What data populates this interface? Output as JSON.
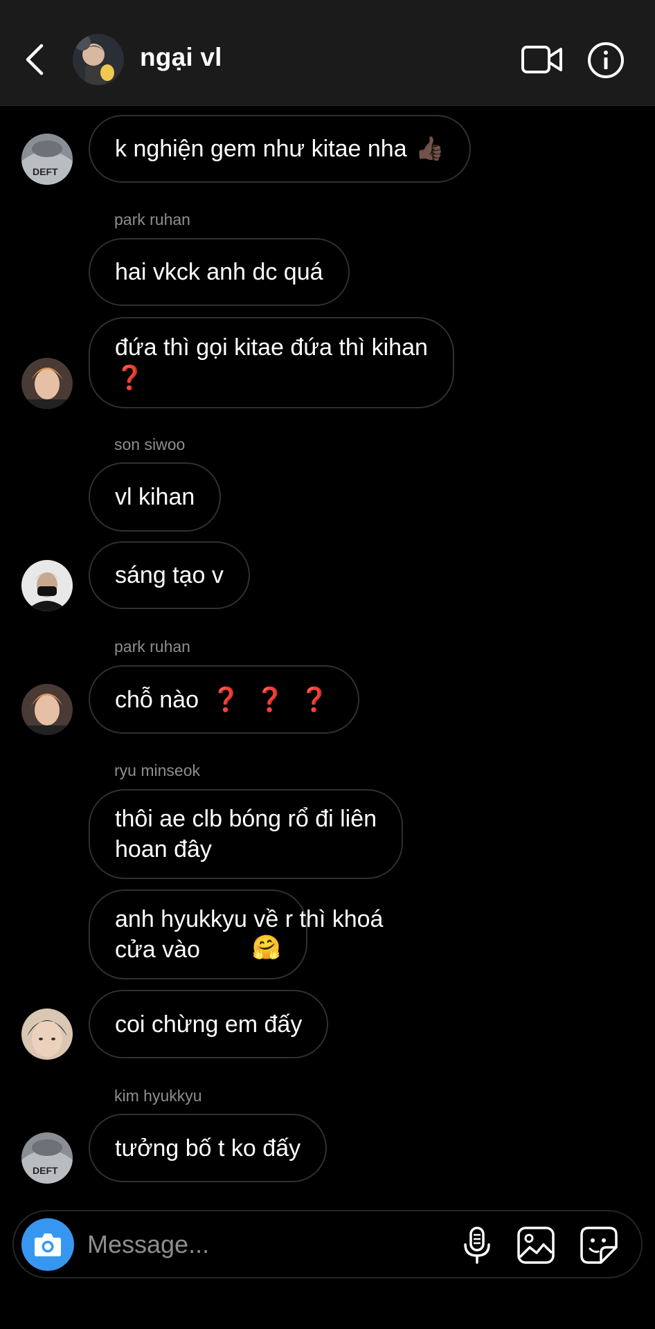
{
  "header": {
    "title": "ngại vl"
  },
  "messages": [
    {
      "sender": "",
      "text": "k nghiện gem như kitae nha",
      "emoji": "👍🏿",
      "avatar": "deft"
    },
    {
      "sender": "park ruhan",
      "text": "hai vkck anh dc quá",
      "avatar": ""
    },
    {
      "sender": "",
      "text": "đứa thì gọi kitae đứa thì kihan",
      "line2": "❓",
      "avatar": "orange"
    },
    {
      "sender": "son siwoo",
      "text": "vl kihan",
      "avatar": ""
    },
    {
      "sender": "",
      "text": "sáng tạo v",
      "avatar": "mask"
    },
    {
      "sender": "park ruhan",
      "text": "chỗ nào",
      "emoji": "❓ ❓ ❓",
      "avatar": "orange"
    },
    {
      "sender": "ryu minseok",
      "text": "thôi ae clb bóng rổ đi liên\nhoan đây",
      "avatar": ""
    },
    {
      "sender": "",
      "text": "anh hyukkyu về r thì khoá\ncửa vào",
      "emoji": "🤗",
      "avatar": ""
    },
    {
      "sender": "",
      "text": "coi chừng em đấy",
      "avatar": "face"
    },
    {
      "sender": "kim hyukkyu",
      "text": "tưởng bố t ko đấy",
      "avatar": "deft"
    }
  ],
  "composer": {
    "placeholder": "Message..."
  },
  "icons": {
    "back": "chevron-left-icon",
    "video": "video-camera-icon",
    "info": "info-icon",
    "camera": "camera-icon",
    "mic": "microphone-icon",
    "gallery": "gallery-icon",
    "sticker": "sticker-icon"
  },
  "colors": {
    "accent": "#3797f0",
    "header_bg": "#1b1b1b",
    "bubble_border": "#303030",
    "sender_text": "#8e8e8e",
    "question_red": "#e0211f"
  }
}
